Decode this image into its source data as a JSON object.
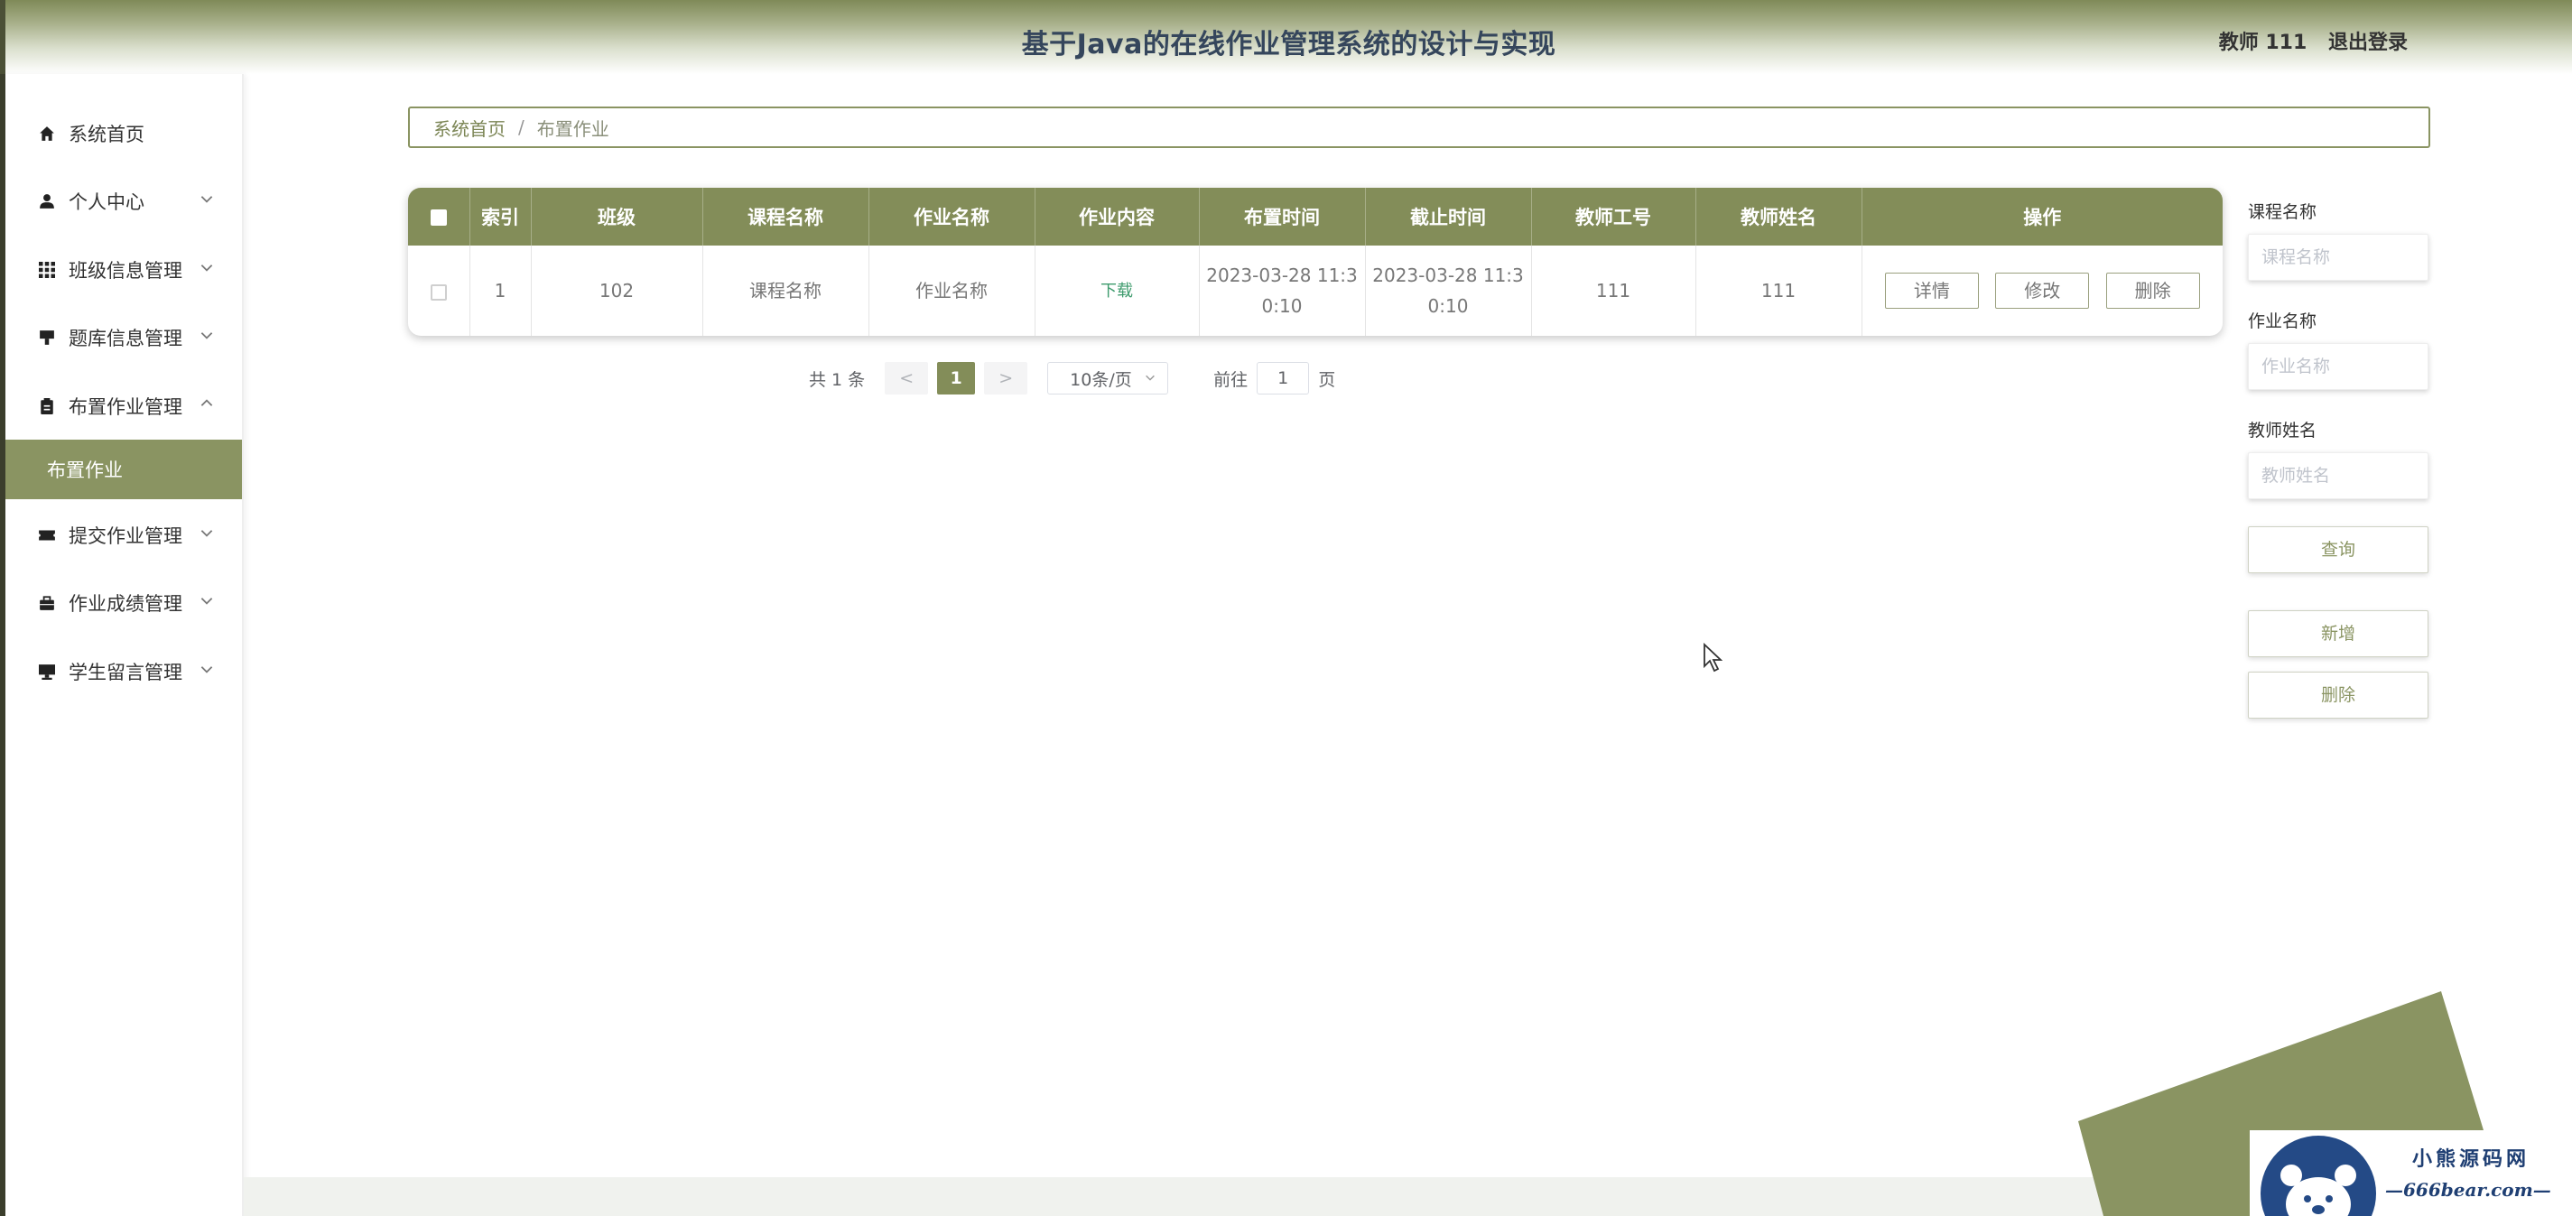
{
  "header": {
    "title": "基于Java的在线作业管理系统的设计与实现",
    "user_label": "教师 111",
    "logout_label": "退出登录"
  },
  "sidebar": {
    "items": [
      {
        "label": "系统首页",
        "icon": "home-icon"
      },
      {
        "label": "个人中心",
        "icon": "user-icon"
      },
      {
        "label": "班级信息管理",
        "icon": "grid-icon"
      },
      {
        "label": "题库信息管理",
        "icon": "stamp-icon"
      },
      {
        "label": "布置作业管理",
        "icon": "clipboard-icon",
        "expanded": true
      },
      {
        "label": "提交作业管理",
        "icon": "ticket-icon"
      },
      {
        "label": "作业成绩管理",
        "icon": "briefcase-icon"
      },
      {
        "label": "学生留言管理",
        "icon": "monitor-icon"
      }
    ],
    "active_sub": "布置作业"
  },
  "breadcrumb": {
    "home": "系统首页",
    "separator": "/",
    "current": "布置作业"
  },
  "table": {
    "columns": [
      "索引",
      "班级",
      "课程名称",
      "作业名称",
      "作业内容",
      "布置时间",
      "截止时间",
      "教师工号",
      "教师姓名",
      "操作"
    ],
    "rows": [
      {
        "index": "1",
        "class": "102",
        "course": "课程名称",
        "homework": "作业名称",
        "content": "下载",
        "assign_time_1": "2023-03-28 11:3",
        "assign_time_2": "0:10",
        "deadline_1": "2023-03-28 11:3",
        "deadline_2": "0:10",
        "teacher_id": "111",
        "teacher_name": "111"
      }
    ],
    "actions": {
      "detail": "详情",
      "edit": "修改",
      "delete": "删除"
    }
  },
  "pagination": {
    "total": "共 1 条",
    "prev": "<",
    "page": "1",
    "next": ">",
    "page_size": "10条/页",
    "goto_label": "前往",
    "goto_value": "1",
    "page_unit": "页"
  },
  "filters": {
    "course_label": "课程名称",
    "course_placeholder": "课程名称",
    "homework_label": "作业名称",
    "homework_placeholder": "作业名称",
    "teacher_label": "教师姓名",
    "teacher_placeholder": "教师姓名",
    "query_button": "查询",
    "add_button": "新增",
    "delete_button": "删除"
  },
  "watermark": {
    "title": "小熊源码网",
    "subtitle": "—666bear.com—"
  },
  "colors": {
    "accent": "#838d59",
    "title": "#35465c",
    "link": "#3e9b6d"
  }
}
